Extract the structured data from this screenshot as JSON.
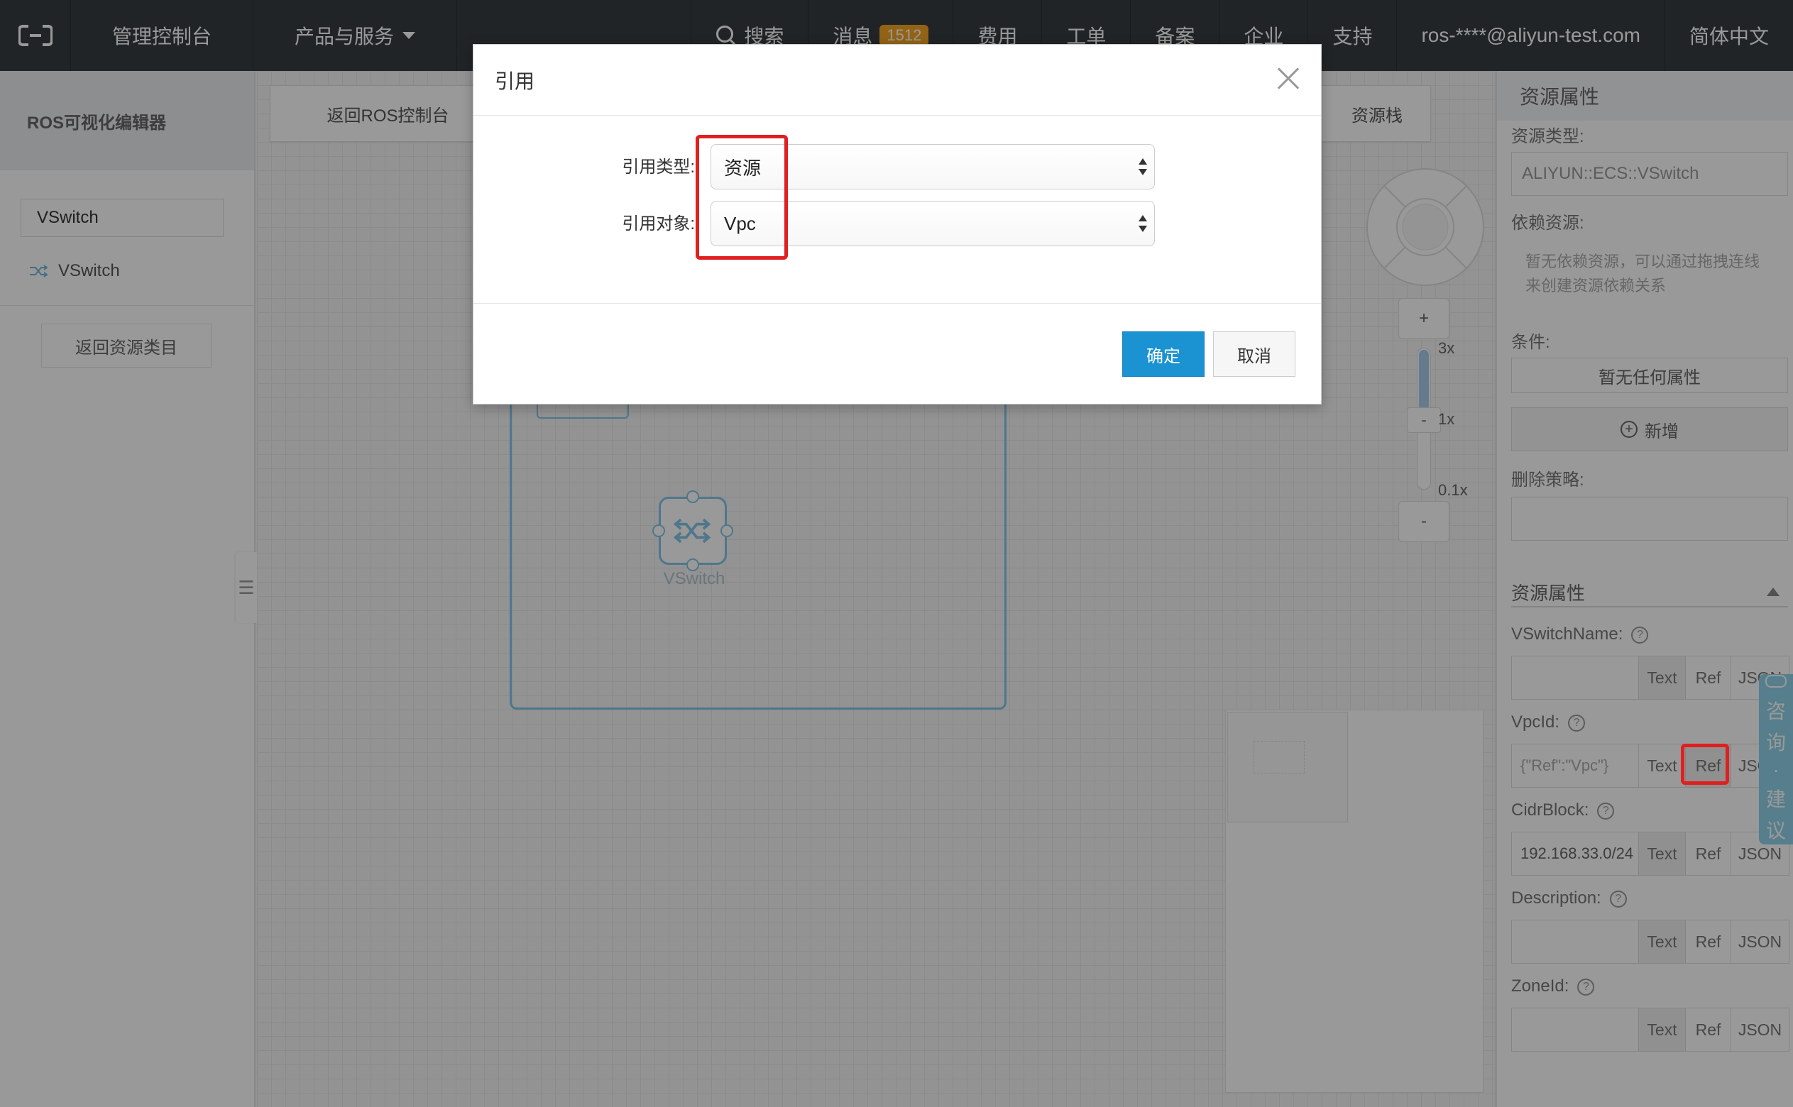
{
  "topbar": {
    "console": "管理控制台",
    "products": "产品与服务",
    "search": "搜索",
    "messages": "消息",
    "message_count": "1512",
    "billing": "费用",
    "tickets": "工单",
    "icp": "备案",
    "enterprise": "企业",
    "support": "支持",
    "account": "ros-****@aliyun-test.com",
    "language": "简体中文"
  },
  "sidebar": {
    "title": "ROS可视化编辑器",
    "search_value": "VSwitch",
    "resource_item": "VSwitch",
    "back_button": "返回资源类目"
  },
  "canvas": {
    "back_button": "返回ROS控制台",
    "stack_button": "资源栈",
    "node_label": "VSwitch",
    "zoom_in": "+",
    "zoom_out": "-",
    "zoom_handle": "-",
    "zoom_max": "3x",
    "zoom_mid": "1x",
    "zoom_min": "0.1x"
  },
  "rpanel": {
    "title": "资源属性",
    "type_label": "资源类型:",
    "type_value": "ALIYUN::ECS::VSwitch",
    "depends_label": "依赖资源:",
    "depends_note": "暂无依赖资源，可以通过拖拽连线来创建资源依赖关系",
    "condition_label": "条件:",
    "condition_value": "暂无任何属性",
    "add_button": "新增",
    "deletion_label": "删除策略:",
    "section_title": "资源属性",
    "seg_text": "Text",
    "seg_ref": "Ref",
    "seg_json": "JSON",
    "props": [
      {
        "label": "VSwitchName:",
        "value": ""
      },
      {
        "label": "VpcId:",
        "value": "{\"Ref\":\"Vpc\"}"
      },
      {
        "label": "CidrBlock:",
        "value": "192.168.33.0/24"
      },
      {
        "label": "Description:",
        "value": ""
      },
      {
        "label": "ZoneId:",
        "value": ""
      }
    ]
  },
  "feedback": {
    "chars": [
      "咨",
      "询",
      "·",
      "建",
      "议"
    ]
  },
  "dialog": {
    "title": "引用",
    "type_label": "引用类型:",
    "type_value": "资源",
    "target_label": "引用对象:",
    "target_value": "Vpc",
    "ok": "确定",
    "cancel": "取消"
  },
  "colors": {
    "topbar_bg": "#373d41",
    "primary": "#1b92d1",
    "highlight": "#e02020",
    "vpc_border": "#82c7e8",
    "badge": "#f5a623"
  }
}
